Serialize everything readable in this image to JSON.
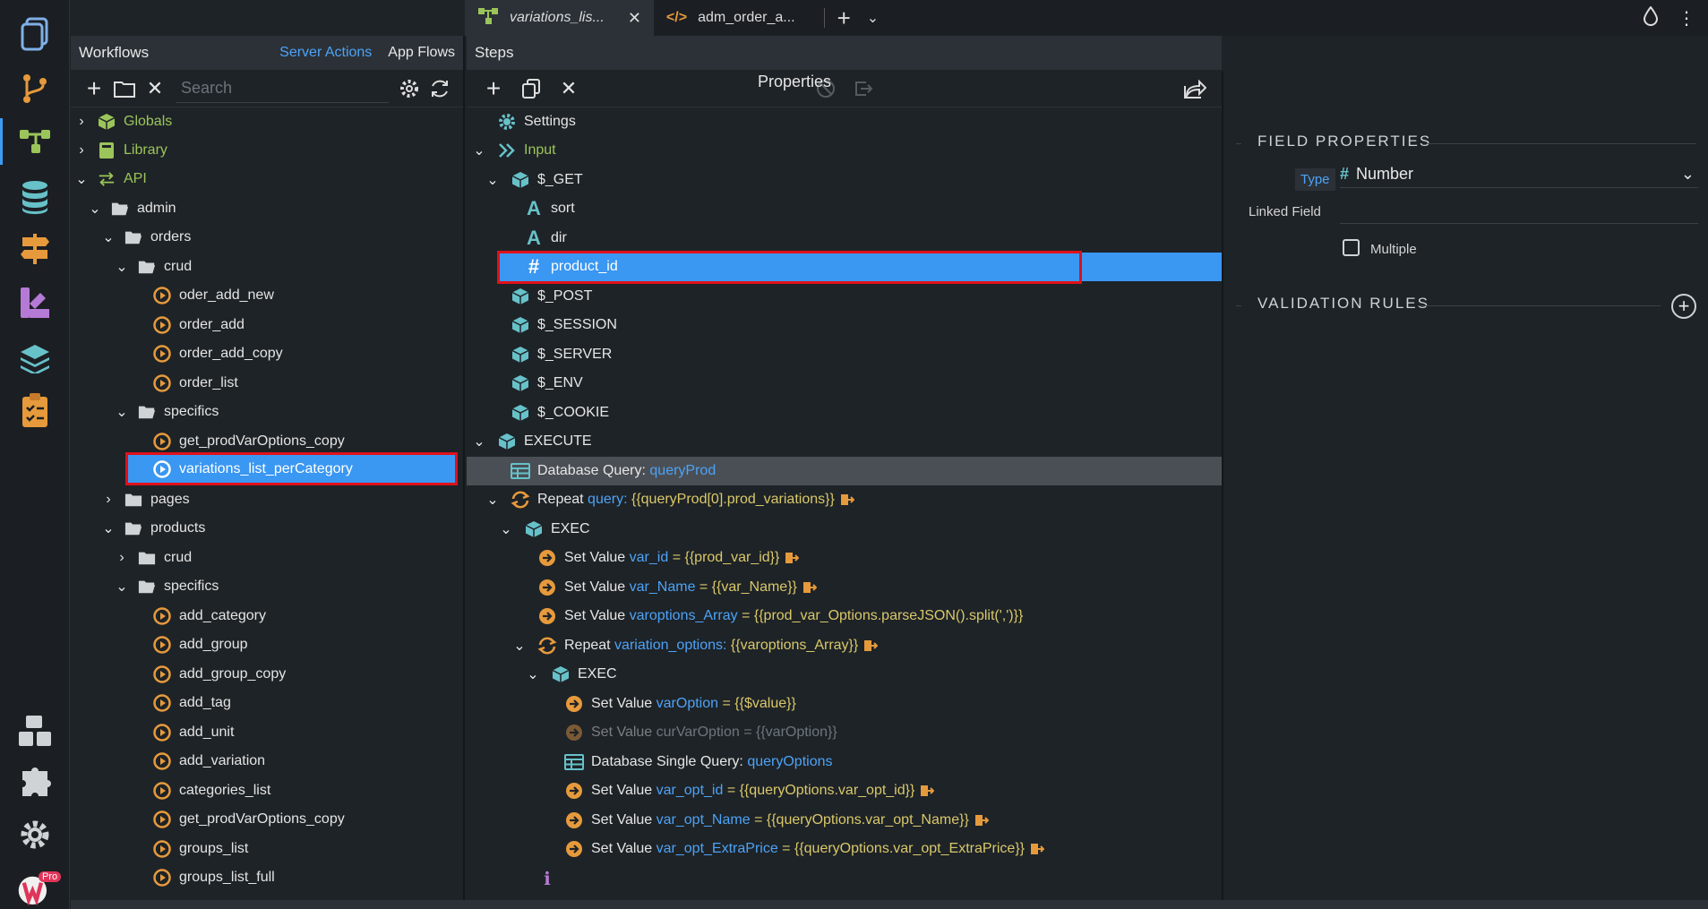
{
  "tabs": {
    "tab1_label": "variations_lis...",
    "tab2_label": "adm_order_a..."
  },
  "workflows": {
    "title": "Workflows",
    "server_actions": "Server Actions",
    "app_flows": "App Flows",
    "search_placeholder": "Search",
    "tree": [
      {
        "label": "Globals"
      },
      {
        "label": "Library"
      },
      {
        "label": "API"
      },
      {
        "label": "admin"
      },
      {
        "label": "orders"
      },
      {
        "label": "crud"
      },
      {
        "label": "oder_add_new"
      },
      {
        "label": "order_add"
      },
      {
        "label": "order_add_copy"
      },
      {
        "label": "order_list"
      },
      {
        "label": "specifics"
      },
      {
        "label": "get_prodVarOptions_copy"
      },
      {
        "label": "variations_list_perCategory"
      },
      {
        "label": "pages"
      },
      {
        "label": "products"
      },
      {
        "label": "crud"
      },
      {
        "label": "specifics"
      },
      {
        "label": "add_category"
      },
      {
        "label": "add_group"
      },
      {
        "label": "add_group_copy"
      },
      {
        "label": "add_tag"
      },
      {
        "label": "add_unit"
      },
      {
        "label": "add_variation"
      },
      {
        "label": "categories_list"
      },
      {
        "label": "get_prodVarOptions_copy"
      },
      {
        "label": "groups_list"
      },
      {
        "label": "groups_list_full"
      }
    ]
  },
  "steps": {
    "title": "Steps",
    "properties_label": "Properties",
    "rows": [
      {
        "label": "Settings"
      },
      {
        "label": "Input"
      },
      {
        "label": "$_GET"
      },
      {
        "label": "sort"
      },
      {
        "label": "dir"
      },
      {
        "label": "product_id"
      },
      {
        "label": "$_POST"
      },
      {
        "label": "$_SESSION"
      },
      {
        "label": "$_SERVER"
      },
      {
        "label": "$_ENV"
      },
      {
        "label": "$_COOKIE"
      },
      {
        "label": "EXECUTE"
      },
      {
        "label": "Database Query:",
        "name": "queryProd"
      },
      {
        "label": "Repeat",
        "key": "query:",
        "value": "{{queryProd[0].prod_variations}}"
      },
      {
        "label": "EXEC"
      },
      {
        "label": "Set Value",
        "key": "var_id",
        "value": "= {{prod_var_id}}"
      },
      {
        "label": "Set Value",
        "key": "var_Name",
        "value": "= {{var_Name}}"
      },
      {
        "label": "Set Value",
        "key": "varoptions_Array",
        "value": "= {{prod_var_Options.parseJSON().split(',')}}"
      },
      {
        "label": "Repeat",
        "key": "variation_options:",
        "value": "{{varoptions_Array}}"
      },
      {
        "label": "EXEC"
      },
      {
        "label": "Set Value",
        "key": "varOption",
        "value": "= {{$value}}"
      },
      {
        "label": "Set Value",
        "key": "curVarOption",
        "value": "= {{varOption}}"
      },
      {
        "label": "Database Single Query:",
        "name": "queryOptions"
      },
      {
        "label": "Set Value",
        "key": "var_opt_id",
        "value": "= {{queryOptions.var_opt_id}}"
      },
      {
        "label": "Set Value",
        "key": "var_opt_Name",
        "value": "= {{queryOptions.var_opt_Name}}"
      },
      {
        "label": "Set Value",
        "key": "var_opt_ExtraPrice",
        "value": "= {{queryOptions.var_opt_ExtraPrice}}"
      }
    ]
  },
  "properties": {
    "field_properties": "FIELD PROPERTIES",
    "type_label": "Type",
    "type_value": "Number",
    "linked_field_label": "Linked Field",
    "multiple_label": "Multiple",
    "validation_rules": "VALIDATION RULES"
  },
  "badge": "Pro",
  "colors": {
    "accent": "#3a97f2",
    "selection_border": "#e0101a",
    "folder_green": "#9bc55a",
    "action_orange": "#e69a3c",
    "teal_icon": "#67c1c9"
  }
}
